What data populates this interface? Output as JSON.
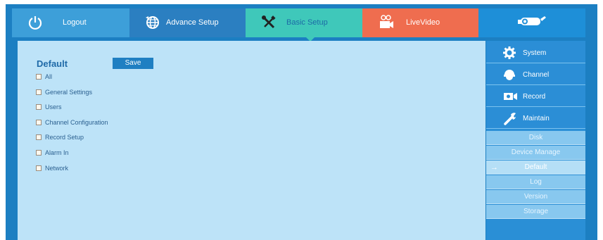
{
  "nav": {
    "tabs": [
      {
        "label": "Logout",
        "icon": "power-icon"
      },
      {
        "label": "Advance Setup",
        "icon": "globe-icon"
      },
      {
        "label": "Basic Setup",
        "icon": "tools-icon"
      },
      {
        "label": "LiveVideo",
        "icon": "camera-icon"
      }
    ],
    "brand_icon": "cctv-camera-logo-icon"
  },
  "content": {
    "title": "Default",
    "save_label": "Save",
    "options": [
      "All",
      "General Settings",
      "Users",
      "Channel Configuration",
      "Record Setup",
      "Alarm In",
      "Network"
    ]
  },
  "sidebar": {
    "items": [
      {
        "label": "System",
        "icon": "gear-icon"
      },
      {
        "label": "Channel",
        "icon": "dome-camera-icon"
      },
      {
        "label": "Record",
        "icon": "record-camera-icon"
      },
      {
        "label": "Maintain",
        "icon": "wrench-icon"
      }
    ],
    "subitems": [
      "Disk",
      "Device Manage",
      "Default",
      "Log",
      "Version",
      "Storage"
    ],
    "active_subitem": "Default",
    "active_marker": "→"
  },
  "colors": {
    "frame": "#1c7fc2",
    "content_bg": "#bde3f8",
    "basic_setup_tab": "#3fc8ba",
    "live_video_tab": "#ef6d4f"
  }
}
